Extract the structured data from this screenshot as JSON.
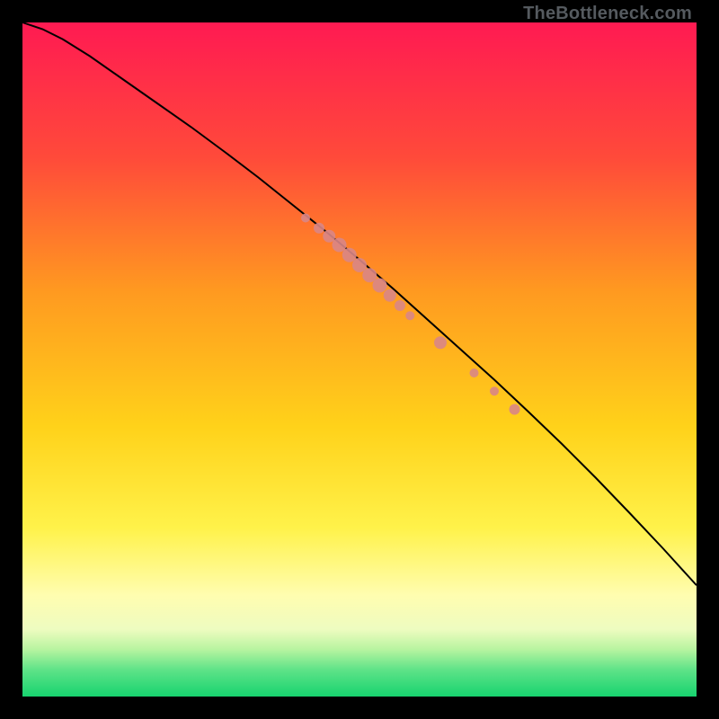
{
  "watermark": "TheBottleneck.com",
  "chart_data": {
    "type": "line",
    "title": "",
    "xlabel": "",
    "ylabel": "",
    "xlim": [
      0,
      100
    ],
    "ylim": [
      0,
      100
    ],
    "grid": false,
    "background_gradient": {
      "stops": [
        {
          "offset": 0.0,
          "color": "#ff1a52"
        },
        {
          "offset": 0.2,
          "color": "#ff4a3a"
        },
        {
          "offset": 0.4,
          "color": "#ff9a20"
        },
        {
          "offset": 0.6,
          "color": "#ffd21a"
        },
        {
          "offset": 0.75,
          "color": "#fff24a"
        },
        {
          "offset": 0.85,
          "color": "#fffdb0"
        },
        {
          "offset": 0.9,
          "color": "#eefcc0"
        },
        {
          "offset": 0.93,
          "color": "#b8f4a0"
        },
        {
          "offset": 0.96,
          "color": "#5fe388"
        },
        {
          "offset": 1.0,
          "color": "#17d36f"
        }
      ]
    },
    "series": [
      {
        "name": "curve",
        "color": "#000000",
        "x": [
          0,
          3,
          6,
          10,
          15,
          20,
          25,
          30,
          35,
          40,
          45,
          50,
          55,
          60,
          65,
          70,
          75,
          80,
          85,
          90,
          95,
          100
        ],
        "y": [
          100,
          99,
          97.5,
          95,
          91.5,
          88,
          84.5,
          80.8,
          77,
          73,
          69,
          64.8,
          60.5,
          56,
          51.5,
          47,
          42.3,
          37.5,
          32.5,
          27.3,
          22,
          16.5
        ]
      }
    ],
    "scatter": {
      "name": "markers",
      "color": "#d98686",
      "points": [
        {
          "x": 42,
          "y": 71,
          "r": 5
        },
        {
          "x": 44,
          "y": 69.5,
          "r": 6
        },
        {
          "x": 45.5,
          "y": 68.3,
          "r": 7
        },
        {
          "x": 47,
          "y": 67,
          "r": 8
        },
        {
          "x": 48.5,
          "y": 65.5,
          "r": 8
        },
        {
          "x": 50,
          "y": 64,
          "r": 8
        },
        {
          "x": 51.5,
          "y": 62.5,
          "r": 8
        },
        {
          "x": 53,
          "y": 61,
          "r": 8
        },
        {
          "x": 54.5,
          "y": 59.5,
          "r": 7
        },
        {
          "x": 56,
          "y": 58,
          "r": 6
        },
        {
          "x": 57.5,
          "y": 56.5,
          "r": 5
        },
        {
          "x": 62,
          "y": 52.5,
          "r": 7
        },
        {
          "x": 67,
          "y": 48,
          "r": 5
        },
        {
          "x": 70,
          "y": 45.3,
          "r": 5
        },
        {
          "x": 73,
          "y": 42.6,
          "r": 6
        }
      ]
    }
  }
}
